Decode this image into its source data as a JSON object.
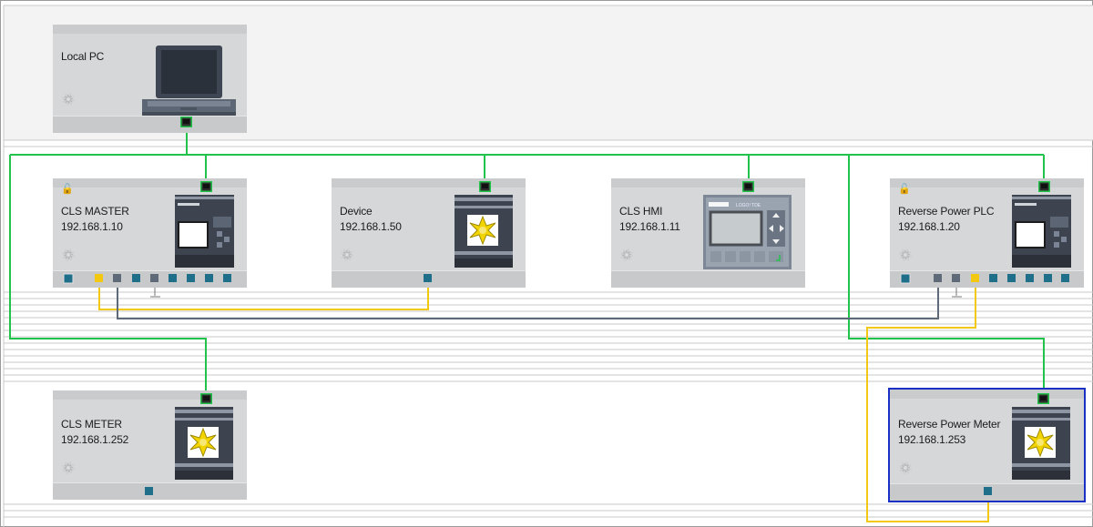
{
  "colors": {
    "ethernet": "#22c34a",
    "io_yellow": "#f2c811",
    "io_gray": "#5e6a78",
    "port_teal": "#1f6e8a",
    "selection": "#1a2fc4",
    "card_bg": "#d6d7d9"
  },
  "devices": [
    {
      "id": "local_pc",
      "name": "Local PC",
      "ip": "",
      "kind": "laptop",
      "icon": "gear-icon"
    },
    {
      "id": "cls_master",
      "name": "CLS MASTER",
      "ip": "192.168.1.10",
      "kind": "logo-plc",
      "locked": true,
      "icon": "gear-icon"
    },
    {
      "id": "device",
      "name": "Device",
      "ip": "192.168.1.50",
      "kind": "meter",
      "icon": "gear-icon"
    },
    {
      "id": "cls_hmi",
      "name": "CLS HMI",
      "ip": "192.168.1.11",
      "kind": "logo-tde",
      "icon": "gear-icon"
    },
    {
      "id": "rev_plc",
      "name": "Reverse Power PLC",
      "ip": "192.168.1.20",
      "kind": "logo-plc",
      "locked": true,
      "icon": "gear-icon"
    },
    {
      "id": "cls_meter",
      "name": "CLS METER",
      "ip": "192.168.1.252",
      "kind": "meter",
      "icon": "gear-icon"
    },
    {
      "id": "rev_meter",
      "name": "Reverse Power Meter",
      "ip": "192.168.1.253",
      "kind": "meter",
      "selected": true,
      "icon": "gear-icon"
    }
  ],
  "hmi_brand": "LOGO! TDE",
  "lock_glyph": "🔓"
}
